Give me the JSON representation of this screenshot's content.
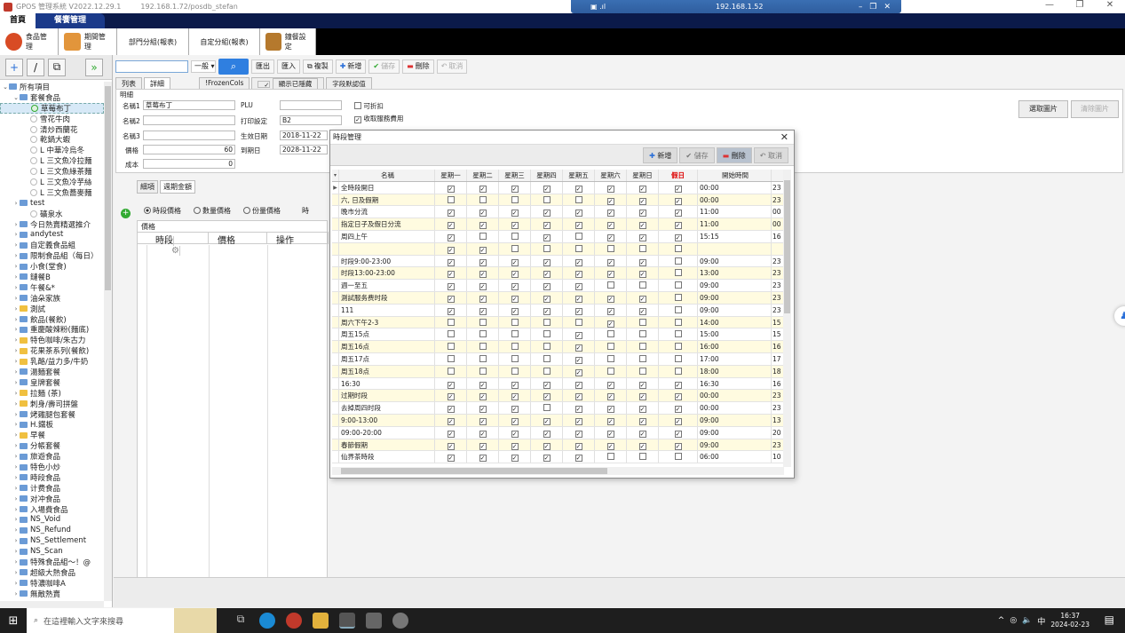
{
  "window": {
    "title": "GPOS 管理系統 V2022.12.29.1",
    "address": "192.168.1.72/posdb_stefan",
    "remote_ip": "192.168.1.52"
  },
  "nav": {
    "home": "首頁",
    "active": "餐饗管理"
  },
  "modules": [
    "食品管理",
    "期間管理",
    "部門分組(報表)",
    "自定分組(報表)",
    "鐘餐設定"
  ],
  "toolbar": {
    "dropdown": "一般",
    "export": "匯出",
    "import": "匯入",
    "copy": "複製",
    "add": "新增",
    "save": "儲存",
    "delete": "刪除",
    "cancel": "取消"
  },
  "tabs": {
    "list": "列表",
    "detail": "詳細",
    "frozen": "!FrozenCols",
    "show_hidden": "顯示已隱藏",
    "field_default": "字段默認值"
  },
  "form": {
    "section": "明細",
    "name1_label": "名稱1",
    "name1_value": "草莓布丁",
    "name2_label": "名稱2",
    "name3_label": "名稱3",
    "price_label": "價格",
    "price_value": "60",
    "cost_label": "成本",
    "cost_value": "0",
    "plu_label": "PLU",
    "print_label": "打印設定",
    "print_value": "B2",
    "start_label": "生效日期",
    "start_value": "2018-11-22",
    "end_label": "到期日",
    "end_value": "2028-11-22",
    "discount_label": "可折扣",
    "service_label": "收取服務費用",
    "pick_image": "選取圖片",
    "clear_image": "清除圖片"
  },
  "subtabs": [
    "細項",
    "週期金額"
  ],
  "radios": [
    "時段價格",
    "數量價格",
    "份量價格"
  ],
  "radio_extra": "時",
  "price_grid": {
    "caption": "價格",
    "cols": [
      "時段",
      "價格",
      "操作"
    ]
  },
  "tree": [
    {
      "label": "所有項目",
      "lvl": 0,
      "arrow": "v",
      "icon": "folder"
    },
    {
      "label": "套餐食品",
      "lvl": 1,
      "arrow": "v",
      "icon": "folder"
    },
    {
      "label": "草莓布丁",
      "lvl": 2,
      "arrow": "",
      "icon": "check",
      "sel": true
    },
    {
      "label": "雪花牛肉",
      "lvl": 2,
      "arrow": "",
      "icon": "dot"
    },
    {
      "label": "清炒西蘭花",
      "lvl": 2,
      "arrow": "",
      "icon": "dot"
    },
    {
      "label": "乾鍋大蝦",
      "lvl": 2,
      "arrow": "",
      "icon": "dot"
    },
    {
      "label": "L 中華冷烏冬",
      "lvl": 2,
      "arrow": "",
      "icon": "dot"
    },
    {
      "label": "L 三文魚冷拉麵",
      "lvl": 2,
      "arrow": "",
      "icon": "dot"
    },
    {
      "label": "L 三文魚綠茶麵",
      "lvl": 2,
      "arrow": "",
      "icon": "dot"
    },
    {
      "label": "L 三文魚冷芋絲",
      "lvl": 2,
      "arrow": "",
      "icon": "dot"
    },
    {
      "label": "L 三文魚蕎麥麵",
      "lvl": 2,
      "arrow": "",
      "icon": "dot"
    },
    {
      "label": "test",
      "lvl": 1,
      "arrow": ">",
      "icon": "folder"
    },
    {
      "label": "礦泉水",
      "lvl": 2,
      "arrow": "",
      "icon": "dot"
    },
    {
      "label": "今日熱賣精選推介",
      "lvl": 1,
      "arrow": ">",
      "icon": "folder"
    },
    {
      "label": "andytest",
      "lvl": 1,
      "arrow": ">",
      "icon": "folder"
    },
    {
      "label": "自定義食品組",
      "lvl": 1,
      "arrow": ">",
      "icon": "folder"
    },
    {
      "label": "限制食品組（每日）",
      "lvl": 1,
      "arrow": ">",
      "icon": "folder"
    },
    {
      "label": "小食(堂食)",
      "lvl": 1,
      "arrow": ">",
      "icon": "folder"
    },
    {
      "label": "鏈餐B",
      "lvl": 1,
      "arrow": ">",
      "icon": "folder"
    },
    {
      "label": "午餐&*",
      "lvl": 1,
      "arrow": ">",
      "icon": "folder"
    },
    {
      "label": "油朵家族",
      "lvl": 1,
      "arrow": ">",
      "icon": "folder"
    },
    {
      "label": "測試",
      "lvl": 1,
      "arrow": ">",
      "icon": "yfolder"
    },
    {
      "label": "飲品(餐飲)",
      "lvl": 1,
      "arrow": ">",
      "icon": "folder"
    },
    {
      "label": "重慶酸辣粉(麵底)",
      "lvl": 1,
      "arrow": ">",
      "icon": "folder"
    },
    {
      "label": "特色咖啡/朱古力",
      "lvl": 1,
      "arrow": ">",
      "icon": "yfolder"
    },
    {
      "label": "花果茶系列(餐飲)",
      "lvl": 1,
      "arrow": ">",
      "icon": "yfolder"
    },
    {
      "label": "乳酪/益力多/牛奶",
      "lvl": 1,
      "arrow": ">",
      "icon": "yfolder"
    },
    {
      "label": "湯麵套餐",
      "lvl": 1,
      "arrow": ">",
      "icon": "folder"
    },
    {
      "label": "皇牌套餐",
      "lvl": 1,
      "arrow": ">",
      "icon": "folder"
    },
    {
      "label": "拉麵 (茶)",
      "lvl": 1,
      "arrow": ">",
      "icon": "yfolder"
    },
    {
      "label": "刺身/壽司拼盤",
      "lvl": 1,
      "arrow": ">",
      "icon": "yfolder"
    },
    {
      "label": "烤雞腿包套餐",
      "lvl": 1,
      "arrow": ">",
      "icon": "folder"
    },
    {
      "label": "H.鐵板",
      "lvl": 1,
      "arrow": ">",
      "icon": "folder"
    },
    {
      "label": "早餐",
      "lvl": 1,
      "arrow": ">",
      "icon": "yfolder"
    },
    {
      "label": "分帳套餐",
      "lvl": 1,
      "arrow": ">",
      "icon": "folder"
    },
    {
      "label": "旅遊食品",
      "lvl": 1,
      "arrow": ">",
      "icon": "folder"
    },
    {
      "label": "特色小炒",
      "lvl": 1,
      "arrow": ">",
      "icon": "folder"
    },
    {
      "label": "時段食品",
      "lvl": 1,
      "arrow": ">",
      "icon": "folder"
    },
    {
      "label": "计费食品",
      "lvl": 1,
      "arrow": ">",
      "icon": "folder"
    },
    {
      "label": "对冲食品",
      "lvl": 1,
      "arrow": ">",
      "icon": "folder"
    },
    {
      "label": "入場費食品",
      "lvl": 1,
      "arrow": ">",
      "icon": "folder"
    },
    {
      "label": "NS_Void",
      "lvl": 1,
      "arrow": ">",
      "icon": "folder"
    },
    {
      "label": "NS_Refund",
      "lvl": 1,
      "arrow": ">",
      "icon": "folder"
    },
    {
      "label": "NS_Settlement",
      "lvl": 1,
      "arrow": ">",
      "icon": "folder"
    },
    {
      "label": "NS_Scan",
      "lvl": 1,
      "arrow": ">",
      "icon": "folder"
    },
    {
      "label": "特殊食品組～！@",
      "lvl": 1,
      "arrow": ">",
      "icon": "folder"
    },
    {
      "label": "超級大熱食品",
      "lvl": 1,
      "arrow": ">",
      "icon": "folder"
    },
    {
      "label": "特濃咖啡A",
      "lvl": 1,
      "arrow": ">",
      "icon": "folder"
    },
    {
      "label": "無敵熱賣",
      "lvl": 1,
      "arrow": ">",
      "icon": "folder"
    }
  ],
  "dialog": {
    "title": "時段管理",
    "add": "新增",
    "save": "儲存",
    "delete": "刪除",
    "cancel": "取消",
    "cols": [
      "名稱",
      "星期一",
      "星期二",
      "星期三",
      "星期四",
      "星期五",
      "星期六",
      "星期日",
      "假日",
      "開始時間"
    ],
    "rows": [
      {
        "name": "全時段開日",
        "d": [
          1,
          1,
          1,
          1,
          1,
          1,
          1,
          1
        ],
        "start": "00:00",
        "end": "23"
      },
      {
        "name": "六, 日及假期",
        "d": [
          0,
          0,
          0,
          0,
          0,
          1,
          1,
          1
        ],
        "start": "00:00",
        "end": "23"
      },
      {
        "name": "晚市分流",
        "d": [
          1,
          1,
          1,
          1,
          1,
          1,
          1,
          1
        ],
        "start": "11:00",
        "end": "00"
      },
      {
        "name": "指定日子及假日分流",
        "d": [
          1,
          1,
          1,
          1,
          1,
          1,
          1,
          1
        ],
        "start": "11:00",
        "end": "00"
      },
      {
        "name": "周四上午",
        "d": [
          1,
          0,
          0,
          1,
          0,
          1,
          1,
          1
        ],
        "start": "15:15",
        "end": "16"
      },
      {
        "name": "",
        "d": [
          1,
          1,
          0,
          0,
          0,
          0,
          0,
          0
        ],
        "start": "",
        "end": ""
      },
      {
        "name": "时段9:00-23:00",
        "d": [
          1,
          1,
          1,
          1,
          1,
          1,
          1,
          0
        ],
        "start": "09:00",
        "end": "23"
      },
      {
        "name": "时段13:00-23:00",
        "d": [
          1,
          1,
          1,
          1,
          1,
          1,
          1,
          0
        ],
        "start": "13:00",
        "end": "23"
      },
      {
        "name": "週一至五",
        "d": [
          1,
          1,
          1,
          1,
          1,
          0,
          0,
          0
        ],
        "start": "09:00",
        "end": "23"
      },
      {
        "name": "測試服务费时段",
        "d": [
          1,
          1,
          1,
          1,
          1,
          1,
          1,
          0
        ],
        "start": "09:00",
        "end": "23"
      },
      {
        "name": "111",
        "d": [
          1,
          1,
          1,
          1,
          1,
          1,
          1,
          0
        ],
        "start": "09:00",
        "end": "23"
      },
      {
        "name": "周六下午2-3",
        "d": [
          0,
          0,
          0,
          0,
          0,
          1,
          0,
          0
        ],
        "start": "14:00",
        "end": "15"
      },
      {
        "name": "周五15点",
        "d": [
          0,
          0,
          0,
          0,
          1,
          0,
          0,
          0
        ],
        "start": "15:00",
        "end": "15"
      },
      {
        "name": "周五16点",
        "d": [
          0,
          0,
          0,
          0,
          1,
          0,
          0,
          0
        ],
        "start": "16:00",
        "end": "16"
      },
      {
        "name": "周五17点",
        "d": [
          0,
          0,
          0,
          0,
          1,
          0,
          0,
          0
        ],
        "start": "17:00",
        "end": "17"
      },
      {
        "name": "周五18点",
        "d": [
          0,
          0,
          0,
          0,
          1,
          0,
          0,
          0
        ],
        "start": "18:00",
        "end": "18"
      },
      {
        "name": "16:30",
        "d": [
          1,
          1,
          1,
          1,
          1,
          1,
          1,
          1
        ],
        "start": "16:30",
        "end": "16"
      },
      {
        "name": "过期时段",
        "d": [
          1,
          1,
          1,
          1,
          1,
          1,
          1,
          1
        ],
        "start": "00:00",
        "end": "23"
      },
      {
        "name": "去掉周四时段",
        "d": [
          1,
          1,
          1,
          0,
          1,
          1,
          1,
          1
        ],
        "start": "00:00",
        "end": "23"
      },
      {
        "name": "9:00-13:00",
        "d": [
          1,
          1,
          1,
          1,
          1,
          1,
          1,
          1
        ],
        "start": "09:00",
        "end": "13"
      },
      {
        "name": "09:00-20:00",
        "d": [
          1,
          1,
          1,
          1,
          1,
          1,
          1,
          1
        ],
        "start": "09:00",
        "end": "20"
      },
      {
        "name": "春節假期",
        "d": [
          1,
          1,
          1,
          1,
          1,
          1,
          1,
          1
        ],
        "start": "09:00",
        "end": "23"
      },
      {
        "name": "仙界茶時段",
        "d": [
          1,
          1,
          1,
          1,
          1,
          0,
          0,
          0
        ],
        "start": "06:00",
        "end": "10"
      }
    ]
  },
  "taskbar": {
    "search": "在這裡輸入文字來搜尋",
    "time": "16:37",
    "date": "2024-02-23",
    "ime": "中"
  },
  "colors": {
    "accent": "#2f7fe0",
    "nav": "#0b1a4a",
    "holiday": "#d00000",
    "alt_row": "#fffbe0"
  }
}
